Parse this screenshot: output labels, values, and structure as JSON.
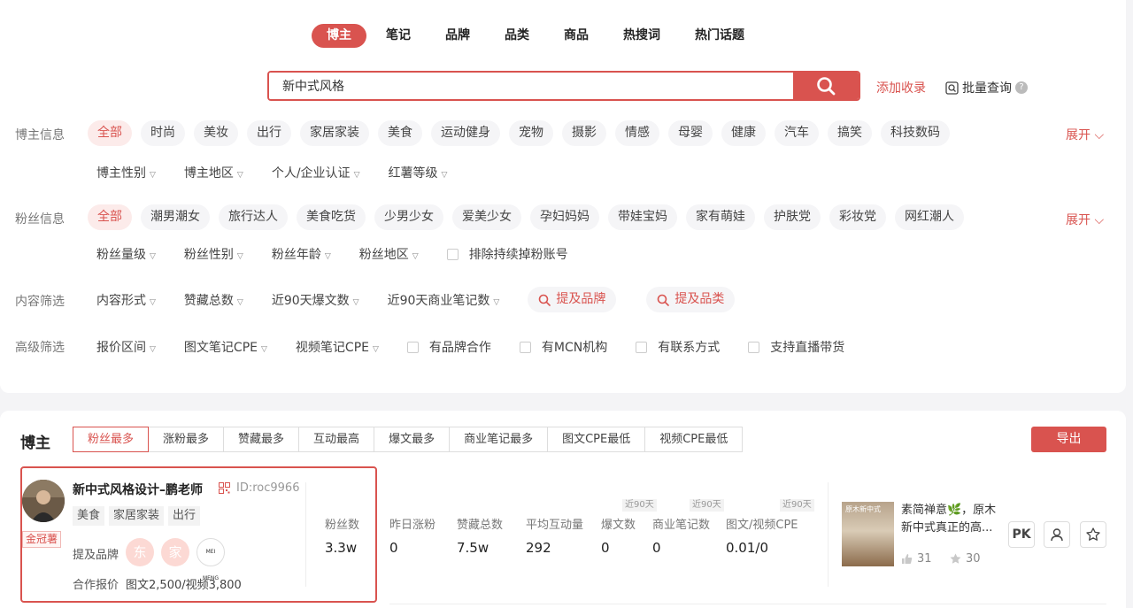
{
  "nav": {
    "tabs": [
      "博主",
      "笔记",
      "品牌",
      "品类",
      "商品",
      "热搜词",
      "热门话题"
    ]
  },
  "search": {
    "value": "新中式风格",
    "add_label": "添加收录",
    "batch_label": "批量查询",
    "help": "?"
  },
  "blogger_info": {
    "label": "博主信息",
    "chips": [
      "全部",
      "时尚",
      "美妆",
      "出行",
      "家居家装",
      "美食",
      "运动健身",
      "宠物",
      "摄影",
      "情感",
      "母婴",
      "健康",
      "汽车",
      "搞笑",
      "科技数码"
    ],
    "expand": "展开",
    "dropdowns": [
      "博主性别",
      "博主地区",
      "个人/企业认证",
      "红薯等级"
    ]
  },
  "fan_info": {
    "label": "粉丝信息",
    "chips": [
      "全部",
      "潮男潮女",
      "旅行达人",
      "美食吃货",
      "少男少女",
      "爱美少女",
      "孕妇妈妈",
      "带娃宝妈",
      "家有萌娃",
      "护肤党",
      "彩妆党",
      "网红潮人"
    ],
    "expand": "展开",
    "dropdowns": [
      "粉丝量级",
      "粉丝性别",
      "粉丝年龄",
      "粉丝地区"
    ],
    "checkbox": "排除持续掉粉账号"
  },
  "content_filter": {
    "label": "内容筛选",
    "dropdowns": [
      "内容形式",
      "赞藏总数",
      "近90天爆文数",
      "近90天商业笔记数"
    ],
    "search_pills": [
      "提及品牌",
      "提及品类"
    ]
  },
  "advanced_filter": {
    "label": "高级筛选",
    "dropdowns": [
      "报价区间",
      "图文笔记CPE",
      "视频笔记CPE"
    ],
    "checkboxes": [
      "有品牌合作",
      "有MCN机构",
      "有联系方式",
      "支持直播带货"
    ]
  },
  "results": {
    "title": "博主",
    "sort_tabs": [
      "粉丝最多",
      "涨粉最多",
      "赞藏最多",
      "互动最高",
      "爆文最多",
      "商业笔记最多",
      "图文CPE最低",
      "视频CPE最低"
    ],
    "export": "导出"
  },
  "blogger": {
    "name": "新中式风格设计–鹏老师",
    "id": "ID:roc9966",
    "badge": "金冠薯",
    "tags": [
      "美食",
      "家居家装",
      "出行"
    ],
    "brand_label": "提及品牌",
    "brands": [
      "东",
      "家",
      "MEI MENG"
    ],
    "price_label": "合作报价",
    "price": "图文2,500/视频3,800",
    "stats": {
      "fans_label": "粉丝数",
      "fans": "3.3w",
      "growth_label": "昨日涨粉",
      "growth": "0",
      "likes_label": "赞藏总数",
      "likes": "7.5w",
      "interaction_label": "平均互动量",
      "interaction": "292",
      "viral_label": "爆文数",
      "viral": "0",
      "commercial_label": "商业笔记数",
      "commercial": "0",
      "cpe_label": "图文/视频CPE",
      "cpe": "0.01/0",
      "period_tag": "近90天"
    },
    "note": {
      "title": "素简禅意🌿，原木新中式真正的高...",
      "thumb_text": "原木新中式",
      "likes": "31",
      "collects": "30"
    },
    "actions": {
      "pk": "PK"
    }
  }
}
